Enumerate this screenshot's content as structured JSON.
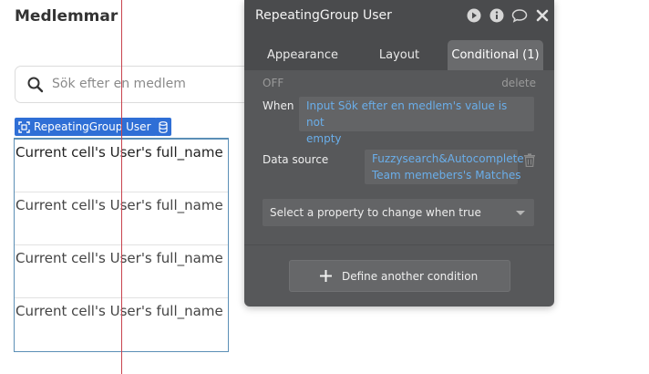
{
  "canvas": {
    "title": "Medlemmar",
    "search": {
      "placeholder": "Sök efter en medlem",
      "icon": "search-icon"
    },
    "repeating_group": {
      "tag_label": "RepeatingGroup User",
      "cells": [
        "Current cell's User's full_name",
        "Current cell's User's full_name",
        "Current cell's User's full_name",
        "Current cell's User's full_name"
      ]
    }
  },
  "panel": {
    "title": "RepeatingGroup User",
    "tabs": [
      {
        "label": "Appearance",
        "active": false
      },
      {
        "label": "Layout",
        "active": false
      },
      {
        "label": "Conditional (1)",
        "active": true
      }
    ],
    "condition": {
      "off_label": "OFF",
      "delete_label": "delete",
      "when_label": "When",
      "when_expression_line1": "Input Sök efter en medlem's value is not",
      "when_expression_line2": "empty",
      "data_source_label": "Data source",
      "data_source_line1": "Fuzzysearch&Autocomplete",
      "data_source_line2": "Team memebers's Matches",
      "property_select": "Select a property to change when true"
    },
    "define_button": "Define another condition"
  },
  "colors": {
    "accent_blue": "#2f6fd6",
    "expression_blue": "#6aaeea",
    "panel_bg": "#57585a",
    "guide_red": "#c8434e"
  }
}
